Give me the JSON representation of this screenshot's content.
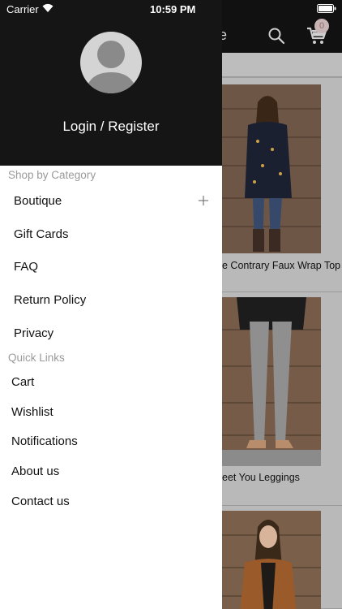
{
  "status_bar": {
    "carrier": "Carrier",
    "time": "10:59 PM"
  },
  "header": {
    "title_fragment": "ue",
    "cart_count": "0"
  },
  "products": [
    {
      "name_fragment": "e Contrary Faux Wrap Top"
    },
    {
      "name_fragment": "eet You Leggings"
    },
    {
      "name_fragment": ""
    }
  ],
  "drawer": {
    "login_label": "Login / Register",
    "shop_by_category": {
      "label": "Shop by Category",
      "items": [
        "Boutique",
        "Gift Cards",
        "FAQ",
        "Return Policy",
        "Privacy"
      ]
    },
    "quick_links": {
      "label": "Quick Links",
      "items": [
        "Cart",
        "Wishlist",
        "Notifications",
        "About us",
        "Contact us"
      ]
    }
  },
  "colors": {
    "header_bg": "#151515",
    "overlay_bg": "#9e9e9e",
    "badge": "#c8b4b4"
  }
}
